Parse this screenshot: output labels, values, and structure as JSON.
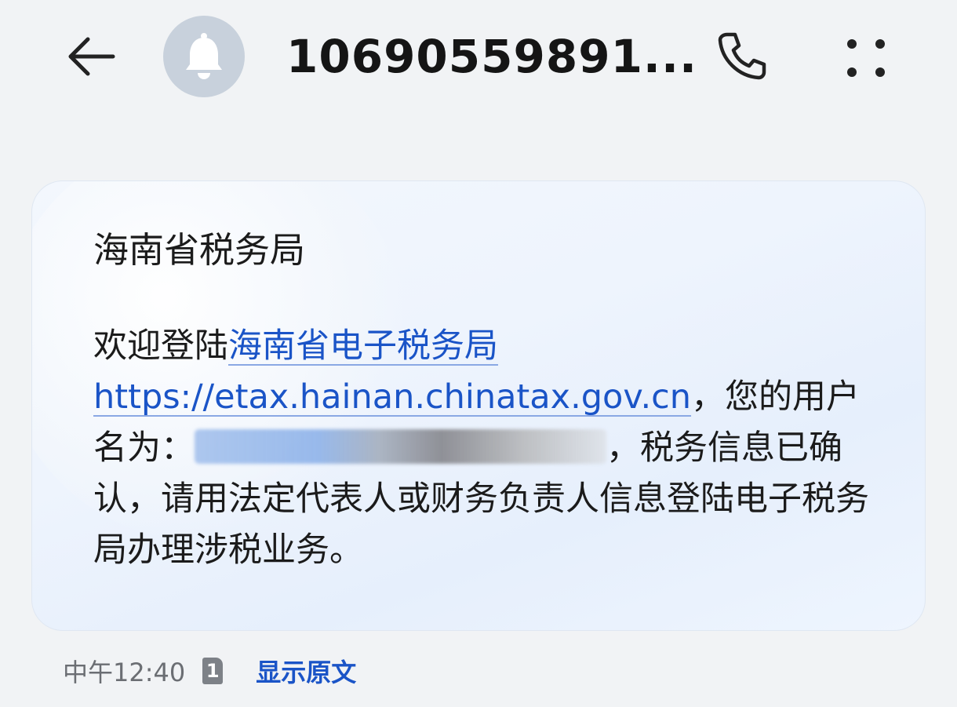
{
  "header": {
    "title": "10690559891...",
    "back_icon": "arrow-left-icon",
    "avatar_icon": "bell-icon",
    "call_icon": "phone-icon",
    "more_icon": "more-dots-icon"
  },
  "message": {
    "sender": "海南省税务局",
    "body_prefix": "欢迎登陆",
    "link_text": "海南省电子税务局https://etax.hainan.chinatax.gov.cn",
    "body_after_link": "，您的用户名为：",
    "body_after_mask": "，税务信息已确认，请用法定代表人或财务负责人信息登陆电子税务局办理涉税业务。"
  },
  "footer": {
    "time": "中午12:40",
    "sim": "1",
    "show_original": "显示原文"
  },
  "colors": {
    "link": "#1a54c7",
    "background": "#f1f3f5",
    "bubble": "#eef4fd"
  }
}
